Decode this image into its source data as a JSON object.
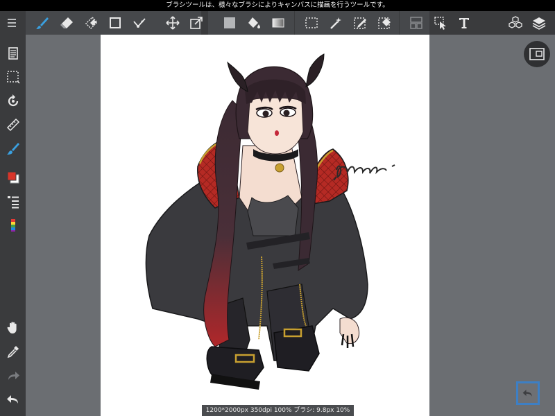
{
  "status_bar": {
    "message": "ブラシツールは、様々なブラシによりキャンバスに描画を行うツールです。"
  },
  "status_info": {
    "text": "1200*2000px 350dpi 100% ブラシ: 9.8px 10%"
  },
  "toolbar": {
    "items": [
      {
        "name": "menu-icon"
      },
      {
        "name": "brush-icon",
        "active": true
      },
      {
        "name": "eraser-icon"
      },
      {
        "name": "blur-eraser-icon"
      },
      {
        "name": "square-shape-icon"
      },
      {
        "name": "snap-icon"
      },
      {
        "name": "move-icon"
      },
      {
        "name": "transform-icon"
      },
      {
        "name": "fill-color-icon"
      },
      {
        "name": "bucket-icon"
      },
      {
        "name": "gradient-icon"
      },
      {
        "name": "select-rect-icon"
      },
      {
        "name": "magic-wand-icon"
      },
      {
        "name": "select-pen-icon"
      },
      {
        "name": "select-eraser-icon"
      },
      {
        "name": "frame-divider-icon"
      },
      {
        "name": "operation-icon"
      },
      {
        "name": "text-tool-icon",
        "glyph": "T"
      },
      {
        "name": "material-icon"
      },
      {
        "name": "layers-icon"
      }
    ]
  },
  "left_toolbar": {
    "items": [
      {
        "name": "document-icon"
      },
      {
        "name": "selection-icon"
      },
      {
        "name": "rotate-icon"
      },
      {
        "name": "ruler-icon"
      },
      {
        "name": "brush-settings-icon"
      },
      {
        "name": "color-swatch-icon"
      },
      {
        "name": "list-icon"
      },
      {
        "name": "palette-bar-icon"
      },
      {
        "name": "hand-icon"
      },
      {
        "name": "eyedropper-icon"
      },
      {
        "name": "redo-icon"
      },
      {
        "name": "undo-icon"
      }
    ]
  },
  "colors": {
    "accent": "#3aa0e0",
    "primary_color": "#d8352a",
    "secondary_color": "#ffffff"
  }
}
